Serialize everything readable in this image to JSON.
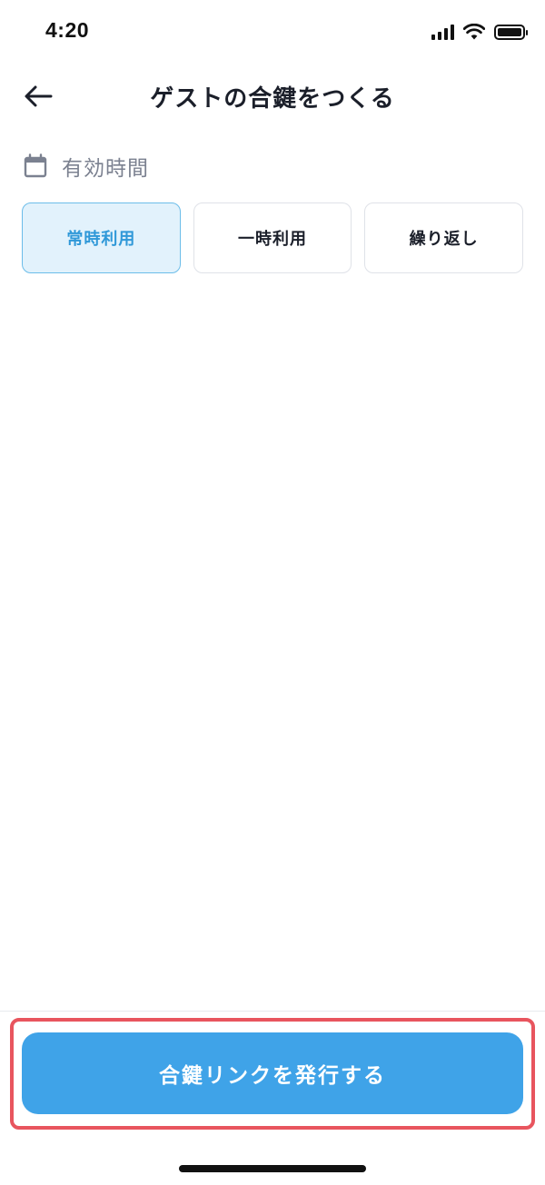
{
  "status_bar": {
    "time": "4:20",
    "icons": [
      "cellular-signal-icon",
      "wifi-icon",
      "battery-icon"
    ],
    "battery_level": 1.0
  },
  "header": {
    "title": "ゲストの合鍵をつくる",
    "back_icon": "arrow-left-icon"
  },
  "validity": {
    "label": "有効時間",
    "icon": "calendar-icon",
    "options": [
      {
        "label": "常時利用",
        "selected": true
      },
      {
        "label": "一時利用",
        "selected": false
      },
      {
        "label": "繰り返し",
        "selected": false
      }
    ]
  },
  "footer": {
    "primary_button_label": "合鍵リンクを発行する"
  },
  "colors": {
    "accent": "#3fa3e8",
    "selected_bg": "#e2f2fc",
    "selected_text": "#2f98d8",
    "highlight": "#e8555e"
  }
}
